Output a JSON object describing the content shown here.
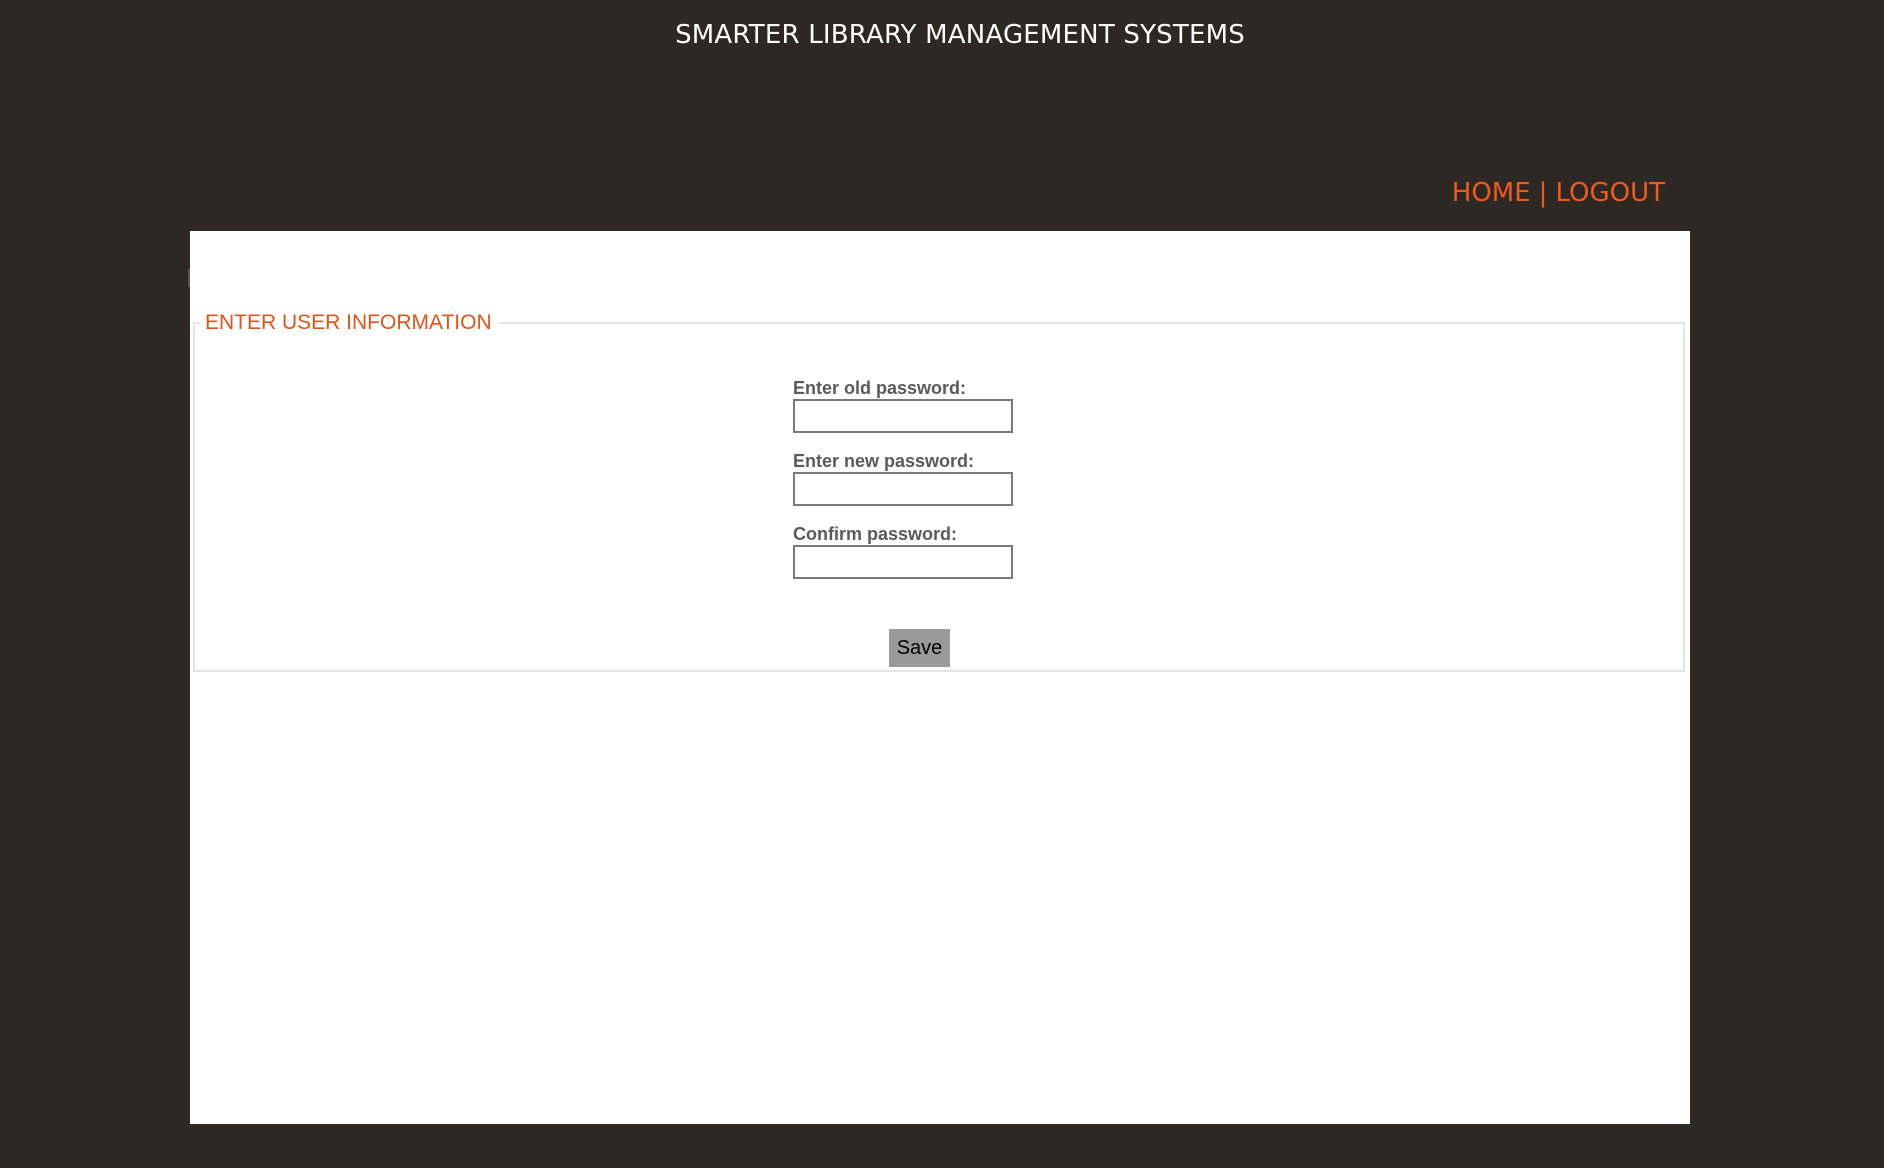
{
  "header": {
    "title": "SMARTER LIBRARY MANAGEMENT SYSTEMS"
  },
  "nav": {
    "home_label": "HOME",
    "separator": "|",
    "logout_label": "LOGOUT"
  },
  "form": {
    "legend": "ENTER USER INFORMATION",
    "fields": [
      {
        "label": "Enter old password:",
        "value": ""
      },
      {
        "label": "Enter new password:",
        "value": ""
      },
      {
        "label": "Confirm password:",
        "value": ""
      }
    ],
    "save_label": "Save"
  },
  "colors": {
    "background": "#2e2824",
    "accent": "#f05a1a",
    "panel": "#ffffff",
    "button": "#9a9a9a"
  }
}
